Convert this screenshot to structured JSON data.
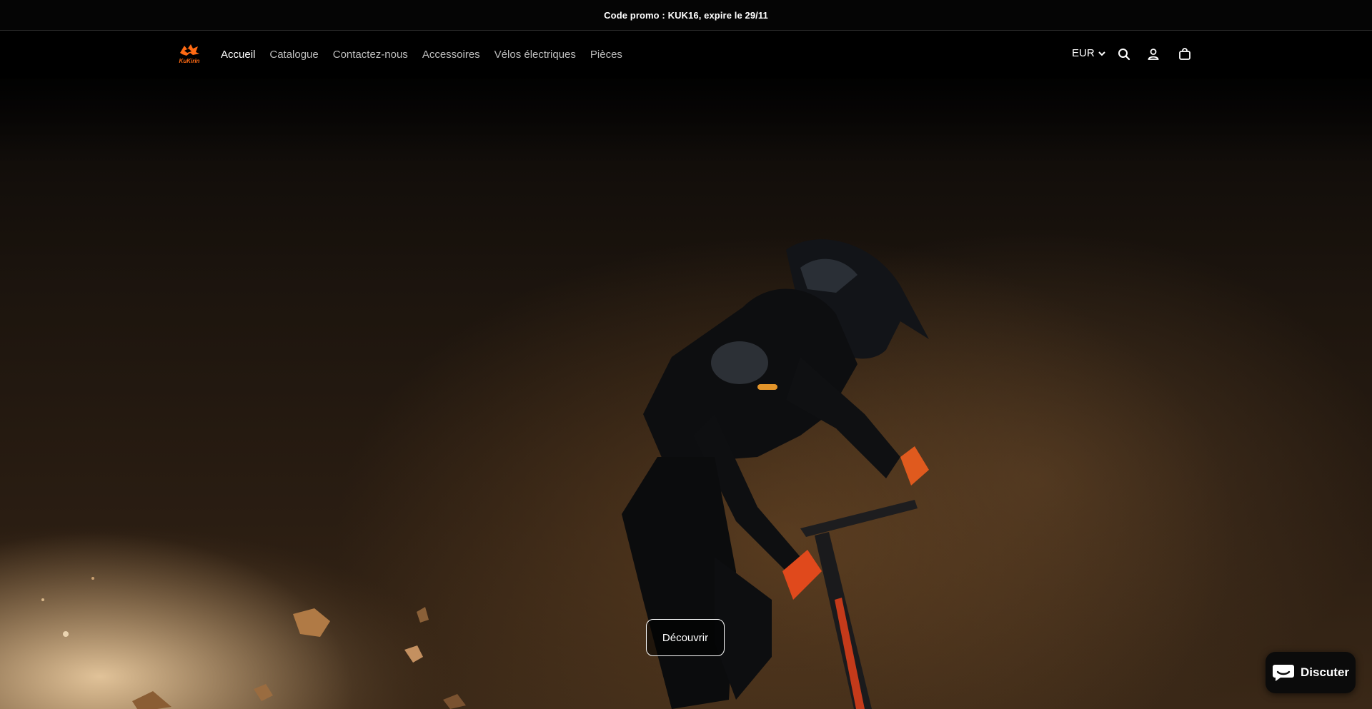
{
  "announcement": {
    "text": "Code promo : KUK16, expire le 29/11"
  },
  "brand": {
    "logo_text": "KuKirin",
    "accent": "#ff6a13"
  },
  "nav": {
    "items": [
      {
        "label": "Accueil",
        "active": true
      },
      {
        "label": "Catalogue",
        "active": false
      },
      {
        "label": "Contactez-nous",
        "active": false
      },
      {
        "label": "Accessoires",
        "active": false
      },
      {
        "label": "Vélos électriques",
        "active": false
      },
      {
        "label": "Pièces",
        "active": false
      }
    ]
  },
  "header": {
    "currency": "EUR",
    "icons": [
      "chevron-down-icon",
      "search-icon",
      "account-icon",
      "cart-icon"
    ]
  },
  "hero": {
    "cta_label": "Découvrir"
  },
  "chat": {
    "label": "Discuter",
    "icon": "chat-bubble-icon"
  }
}
